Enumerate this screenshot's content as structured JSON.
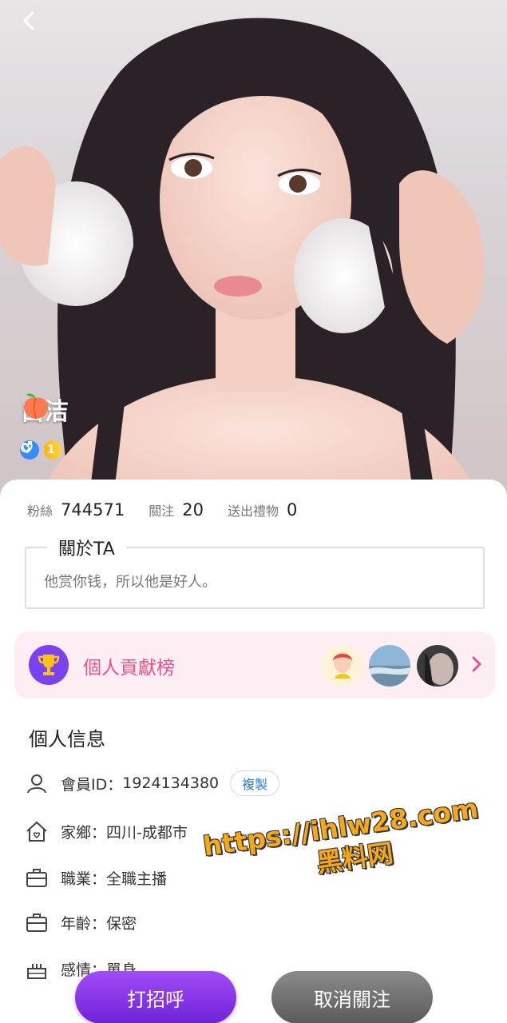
{
  "profile": {
    "nickname": "白洁",
    "level": "1"
  },
  "stats": {
    "fans_label": "粉絲",
    "fans_value": "744571",
    "following_label": "關注",
    "following_value": "20",
    "gifts_label": "送出禮物",
    "gifts_value": "0"
  },
  "about": {
    "title": "關於TA",
    "text": "他赏你钱，所以他是好人。"
  },
  "contribution": {
    "label": "個人貢獻榜"
  },
  "info": {
    "title": "個人信息",
    "member_id_label": "會員ID：",
    "member_id_value": "1924134380",
    "copy_label": "複製",
    "hometown_label": "家鄉：",
    "hometown_value": "四川-成都市",
    "job_label": "職業：",
    "job_value": "全職主播",
    "age_label": "年齡：",
    "age_value": "保密",
    "relationship_label": "感情：",
    "relationship_value": "單身"
  },
  "actions": {
    "greet_label": "打招呼",
    "unfollow_label": "取消關注"
  },
  "watermark": {
    "url": "https://ihlw28.com",
    "site": "黑料网"
  },
  "colors": {
    "accent_pink": "#e4528a",
    "rank_bg": "#fdeef3",
    "greet_purple": "#7b2de0",
    "link_blue": "#2b7bd8"
  }
}
